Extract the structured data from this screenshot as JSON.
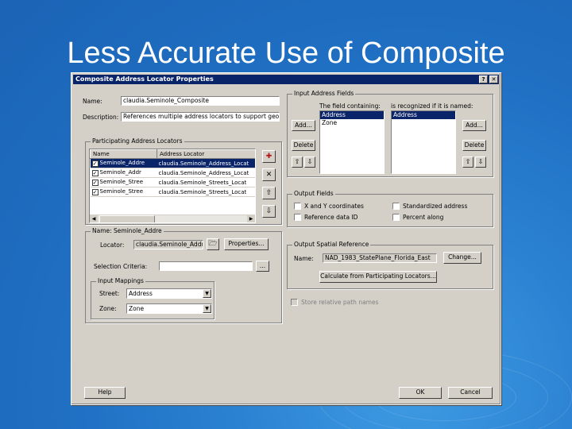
{
  "slide": {
    "title": "Less Accurate Use of Composite"
  },
  "dialog": {
    "title": "Composite Address Locator Properties",
    "help_icon": "?",
    "close_icon": "✕",
    "name_label": "Name:",
    "name_value": "claudia.Seminole_Composite",
    "description_label": "Description:",
    "description_value": "References multiple address locators to support geoco",
    "input_fields": {
      "title": "Input Address Fields",
      "col1_label": "The field containing:",
      "col2_label": "is recognized if it is named:",
      "fields": [
        {
          "text": "Address",
          "selected": true
        },
        {
          "text": "Zone",
          "selected": false
        }
      ],
      "names": [
        {
          "text": "Address",
          "selected": true
        }
      ],
      "add_left": "Add...",
      "delete_left": "Delete",
      "add_right": "Add...",
      "delete_right": "Delete"
    },
    "participating": {
      "title": "Participating Address Locators",
      "columns": [
        "Name",
        "Address Locator"
      ],
      "rows": [
        {
          "name": "Seminole_Addre",
          "locator": "claudia.Seminole_Address_Locat",
          "checked": true,
          "selected": true
        },
        {
          "name": "Seminole_Addr",
          "locator": "claudia.Seminole_Address_Locat",
          "checked": true,
          "selected": false
        },
        {
          "name": "Seminole_Stree",
          "locator": "claudia.Seminole_Streets_Locat",
          "checked": true,
          "selected": false
        },
        {
          "name": "Seminole_Stree",
          "locator": "claudia.Seminole_Streets_Locat",
          "checked": true,
          "selected": false
        }
      ]
    },
    "name_section": {
      "title": "Name: Seminole_Addre",
      "locator_label": "Locator:",
      "locator_value": "claudia.Seminole_Addr",
      "properties_button": "Properties...",
      "selection_label": "Selection Criteria:",
      "selection_button": "...",
      "input_mappings_title": "Input Mappings",
      "street_label": "Street:",
      "street_value": "Address",
      "zone_label": "Zone:",
      "zone_value": "Zone"
    },
    "output_fields": {
      "title": "Output Fields",
      "options": [
        {
          "text": "X and Y coordinates"
        },
        {
          "text": "Standardized address"
        },
        {
          "text": "Reference data ID"
        },
        {
          "text": "Percent along"
        }
      ]
    },
    "spatial_ref": {
      "title": "Output Spatial Reference",
      "name_label": "Name:",
      "name_value": "NAD_1983_StatePlane_Florida_East",
      "change_button": "Change...",
      "calc_button": "Calculate from Participating Locators..."
    },
    "store_label": "Store relative path names",
    "help_button": "Help",
    "ok_button": "OK",
    "cancel_button": "Cancel"
  }
}
